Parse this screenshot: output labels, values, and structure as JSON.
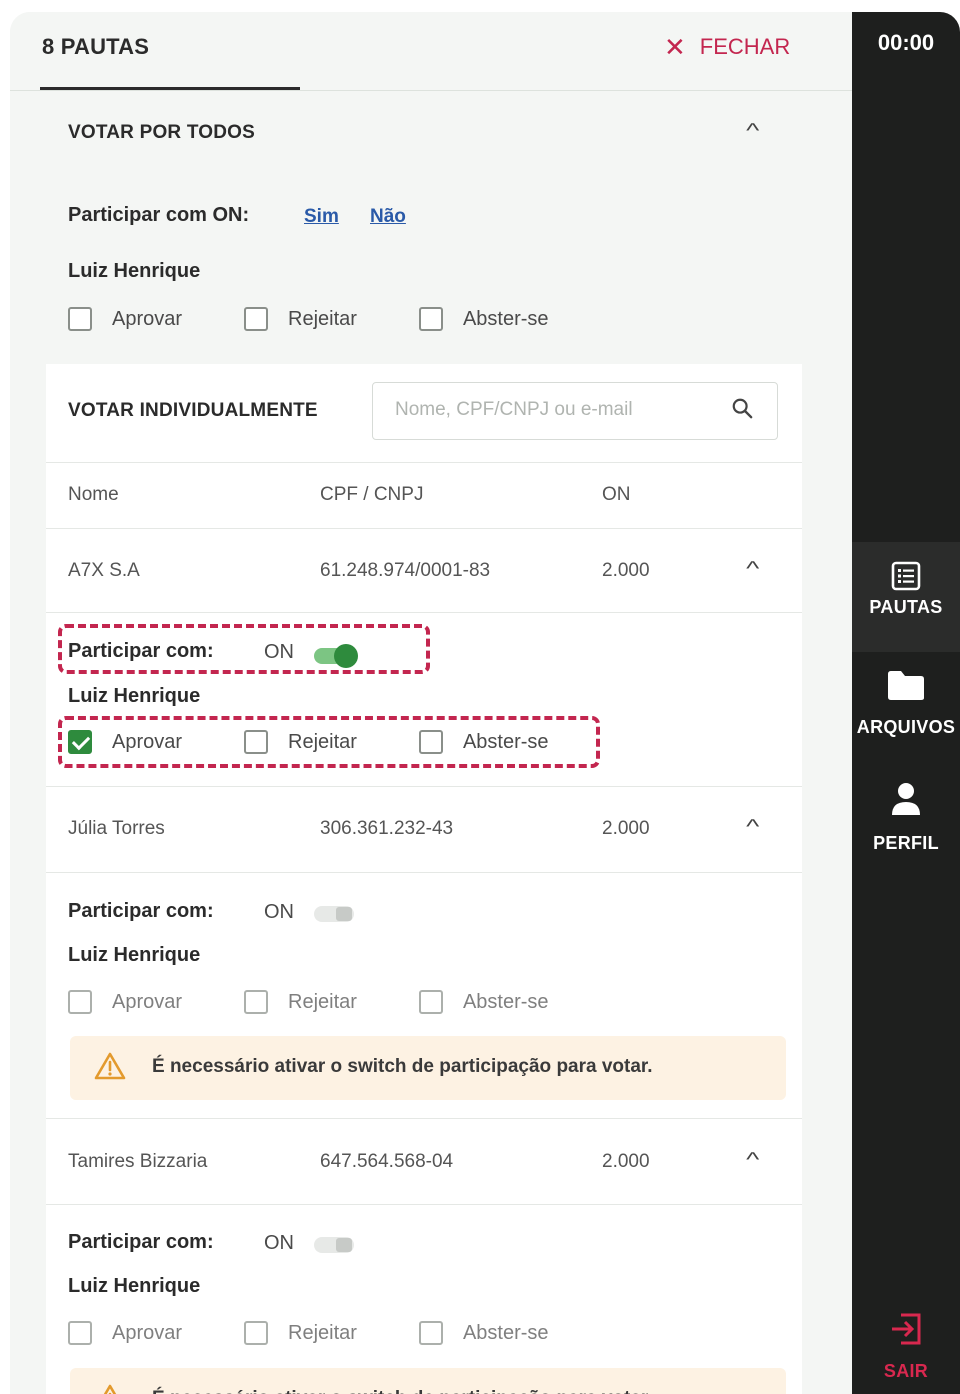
{
  "header": {
    "count_title": "8 PAUTAS",
    "close_label": "FECHAR"
  },
  "vote_all": {
    "title": "VOTAR POR TODOS",
    "participate_label": "Participar com ON:",
    "yes_link": "Sim",
    "no_link": "Não",
    "user_name": "Luiz Henrique",
    "options": [
      "Aprovar",
      "Rejeitar",
      "Abster-se"
    ]
  },
  "vote_individual": {
    "title": "VOTAR INDIVIDUALMENTE",
    "search_placeholder": "Nome, CPF/CNPJ ou e-mail",
    "columns": [
      "Nome",
      "CPF / CNPJ",
      "ON"
    ],
    "participate_label": "Participar com:",
    "on_label": "ON",
    "warning": "É necessário ativar o switch de participação para votar.",
    "rows": [
      {
        "name": "A7X S.A",
        "doc": "61.248.974/0001-83",
        "on": "2.000",
        "participating": true,
        "user": "Luiz Henrique",
        "checked": "Aprovar"
      },
      {
        "name": "Júlia Torres",
        "doc": "306.361.232-43",
        "on": "2.000",
        "participating": false,
        "user": "Luiz Henrique",
        "checked": ""
      },
      {
        "name": "Tamires Bizzaria",
        "doc": "647.564.568-04",
        "on": "2.000",
        "participating": false,
        "user": "Luiz Henrique",
        "checked": ""
      }
    ]
  },
  "options": {
    "approve": "Aprovar",
    "reject": "Rejeitar",
    "abstain": "Abster-se"
  },
  "sidebar": {
    "timer": "00:00",
    "items": [
      {
        "label": "PAUTAS",
        "icon": "list-icon",
        "active": true
      },
      {
        "label": "ARQUIVOS",
        "icon": "folder-icon",
        "active": false
      },
      {
        "label": "PERFIL",
        "icon": "person-icon",
        "active": false
      }
    ],
    "logout": "SAIR"
  },
  "colors": {
    "accent_red": "#c3264f",
    "accent_green": "#2e8b3d",
    "link_blue": "#2a5aa8",
    "sidebar_bg": "#1e1f1e",
    "active_bar": "#2454a3"
  }
}
